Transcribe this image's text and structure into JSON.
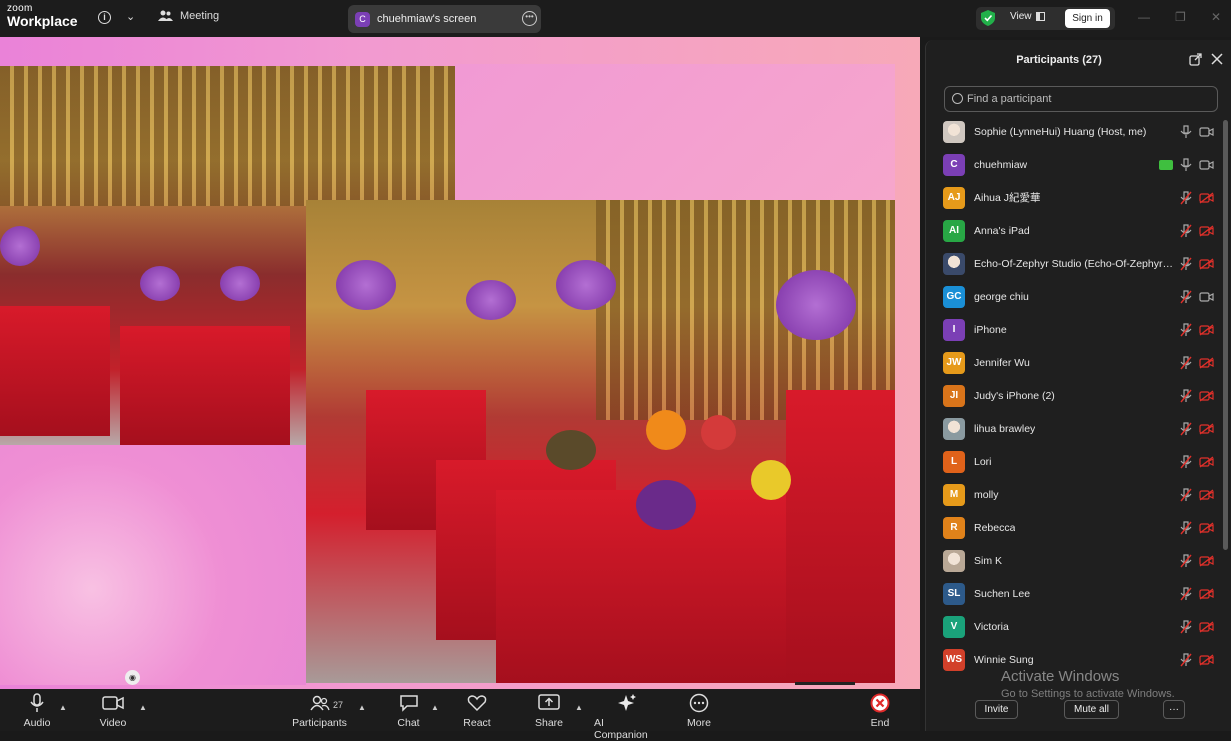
{
  "app": {
    "logo_top": "zoom",
    "logo_bottom": "Workplace"
  },
  "header": {
    "meeting_label": "Meeting",
    "shared_screen_label": "chuehmiaw's screen",
    "shared_screen_avatar": "C",
    "view_label": "View",
    "signin_label": "Sign in"
  },
  "toolbar": {
    "audio": "Audio",
    "video": "Video",
    "participants": "Participants",
    "participants_count": "27",
    "chat": "Chat",
    "react": "React",
    "share": "Share",
    "ai_companion": "AI Companion",
    "more": "More",
    "end": "End"
  },
  "panel": {
    "title": "Participants (27)",
    "search_placeholder": "Find a participant",
    "invite_label": "Invite",
    "mute_all_label": "Mute all",
    "more_label": "···",
    "participants": [
      {
        "initials": "",
        "name": "Sophie (LynneHui) Huang (Host, me)",
        "color": "#cfc7c0",
        "photo": true,
        "mic": "on",
        "cam": "on"
      },
      {
        "initials": "C",
        "name": "chuehmiaw",
        "color": "#7b3fb5",
        "mic": "on",
        "cam": "on",
        "sharing": true
      },
      {
        "initials": "AJ",
        "name": "Aihua J紀愛華",
        "color": "#e69a1a",
        "mic": "off",
        "cam": "off"
      },
      {
        "initials": "AI",
        "name": "Anna's iPad",
        "color": "#28a745",
        "mic": "off",
        "cam": "off"
      },
      {
        "initials": "",
        "name": "Echo-Of-Zephyr Studio (Echo-Of-Zephyr St...",
        "color": "#3a4a6a",
        "photo": true,
        "mic": "off",
        "cam": "off"
      },
      {
        "initials": "GC",
        "name": "george chiu",
        "color": "#1a8fd6",
        "mic": "off",
        "cam": "on"
      },
      {
        "initials": "I",
        "name": "iPhone",
        "color": "#7b3fb5",
        "mic": "off",
        "cam": "off"
      },
      {
        "initials": "JW",
        "name": "Jennifer Wu",
        "color": "#e69a1a",
        "mic": "off",
        "cam": "off"
      },
      {
        "initials": "JI",
        "name": "Judy's iPhone (2)",
        "color": "#d9741a",
        "mic": "off",
        "cam": "off"
      },
      {
        "initials": "",
        "name": "lihua brawley",
        "color": "#8a9aa0",
        "photo": true,
        "mic": "off",
        "cam": "off"
      },
      {
        "initials": "L",
        "name": "Lori",
        "color": "#e0621a",
        "mic": "off",
        "cam": "off"
      },
      {
        "initials": "M",
        "name": "molly",
        "color": "#e69a1a",
        "mic": "off",
        "cam": "off"
      },
      {
        "initials": "R",
        "name": "Rebecca",
        "color": "#e0821a",
        "mic": "off",
        "cam": "off"
      },
      {
        "initials": "",
        "name": "Sim K",
        "color": "#b9a896",
        "photo": true,
        "mic": "off",
        "cam": "off"
      },
      {
        "initials": "SL",
        "name": "Suchen Lee",
        "color": "#2d5a8a",
        "mic": "off",
        "cam": "off"
      },
      {
        "initials": "V",
        "name": "Victoria",
        "color": "#1aa27a",
        "mic": "off",
        "cam": "off"
      },
      {
        "initials": "WS",
        "name": "Winnie Sung",
        "color": "#d2402a",
        "mic": "off",
        "cam": "off"
      }
    ]
  },
  "overlay": {
    "activate_title": "Activate Windows",
    "activate_sub": "Go to Settings to activate Windows."
  }
}
